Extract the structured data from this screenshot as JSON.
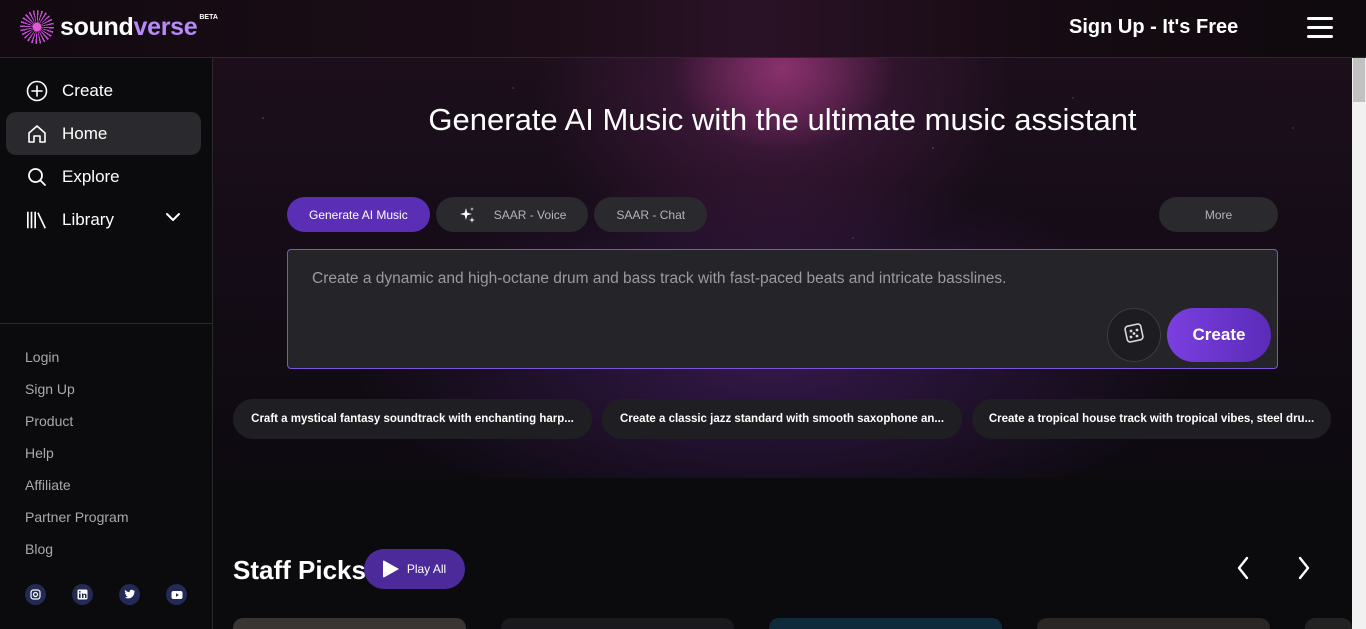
{
  "brand": {
    "name_part1": "sound",
    "name_part2": "verse",
    "badge": "BETA"
  },
  "header": {
    "signup_cta": "Sign Up - It's Free",
    "menu_icon": "hamburger-icon"
  },
  "sidebar": {
    "nav": [
      {
        "label": "Create",
        "icon": "plus-circle-icon"
      },
      {
        "label": "Home",
        "icon": "home-icon",
        "active": true
      },
      {
        "label": "Explore",
        "icon": "search-icon"
      },
      {
        "label": "Library",
        "icon": "library-icon"
      }
    ],
    "footer_links": [
      "Login",
      "Sign Up",
      "Product",
      "Help",
      "Affiliate",
      "Partner Program",
      "Blog"
    ],
    "socials": [
      "instagram-icon",
      "linkedin-icon",
      "twitter-icon",
      "youtube-icon"
    ]
  },
  "hero": {
    "title": "Generate AI Music with the ultimate music assistant",
    "tabs": [
      {
        "label": "Generate AI Music",
        "active": true
      },
      {
        "label": "SAAR - Voice",
        "icon": "sparkle-icon"
      },
      {
        "label": "SAAR - Chat"
      }
    ],
    "more_label": "More",
    "prompt_placeholder": "Create a dynamic and high-octane drum and bass track with fast-paced beats and intricate basslines.",
    "create_label": "Create"
  },
  "suggestions": [
    "Craft a mystical fantasy soundtrack with enchanting harp...",
    "Create a classic jazz standard with smooth saxophone an...",
    "Create a tropical house track with tropical vibes, steel dru..."
  ],
  "staff_picks": {
    "title": "Staff Picks",
    "play_all_label": "Play All"
  },
  "colors": {
    "accent": "#5b2fb5",
    "create_button": "#7b3fe0",
    "background": "#0b0b0d"
  }
}
